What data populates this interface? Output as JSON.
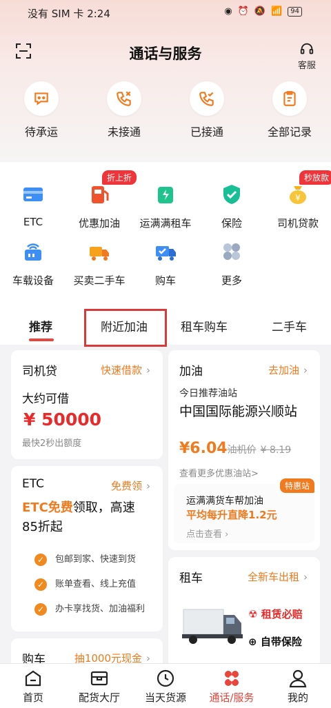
{
  "status": {
    "text": "没有 SIM 卡 2:24",
    "battery": "94"
  },
  "header": {
    "title": "通话与服务",
    "service": "客服"
  },
  "calls": [
    {
      "label": "待承运"
    },
    {
      "label": "未接通"
    },
    {
      "label": "已接通"
    },
    {
      "label": "全部记录"
    }
  ],
  "services": [
    {
      "label": "ETC"
    },
    {
      "label": "优惠加油",
      "badge": "折上折"
    },
    {
      "label": "运满满租车"
    },
    {
      "label": "保险"
    },
    {
      "label": "司机贷款",
      "badge": "秒放款"
    },
    {
      "label": "车载设备"
    },
    {
      "label": "买卖二手车"
    },
    {
      "label": "购车"
    },
    {
      "label": "更多"
    }
  ],
  "tabs": [
    "推荐",
    "附近加油",
    "租车购车",
    "二手车"
  ],
  "loan": {
    "title": "司机贷",
    "action": "快速借款",
    "desc": "大约可借",
    "amount": "¥ 50000",
    "note": "最快2秒出额度"
  },
  "fuel": {
    "title": "加油",
    "action": "去加油",
    "rec": "今日推荐油站",
    "station": "中国国际能源兴顺站",
    "price": "¥6.04",
    "orig_label": "油机价",
    "orig_price": "¥ 8.19",
    "more": "查看更多优惠油站>",
    "promo_badge": "特惠站",
    "promo_title": "运满满货车帮加油",
    "promo_sub": "平均每升直降1.2元",
    "promo_link": "点击查看"
  },
  "etc": {
    "title": "ETC",
    "action": "免费领",
    "line1a": "ETC免费",
    "line1b": "领取，高速",
    "line2": "85折起",
    "features": [
      "包邮到家、快速到货",
      "账单查看、线上充值",
      "办卡享找货、加油福利"
    ]
  },
  "rent": {
    "title": "租车",
    "action": "全新车出租",
    "tag1": "租赁必赔",
    "tag2": "自带保险"
  },
  "buy": {
    "title": "购车",
    "action": "抽1000元现金"
  },
  "nav": [
    {
      "label": "首页"
    },
    {
      "label": "配货大厅"
    },
    {
      "label": "当天货源"
    },
    {
      "label": "通话/服务"
    },
    {
      "label": "我的"
    }
  ],
  "colors": {
    "accent": "#e8453c",
    "orange": "#f07a1e",
    "badge": "#f0353a"
  }
}
